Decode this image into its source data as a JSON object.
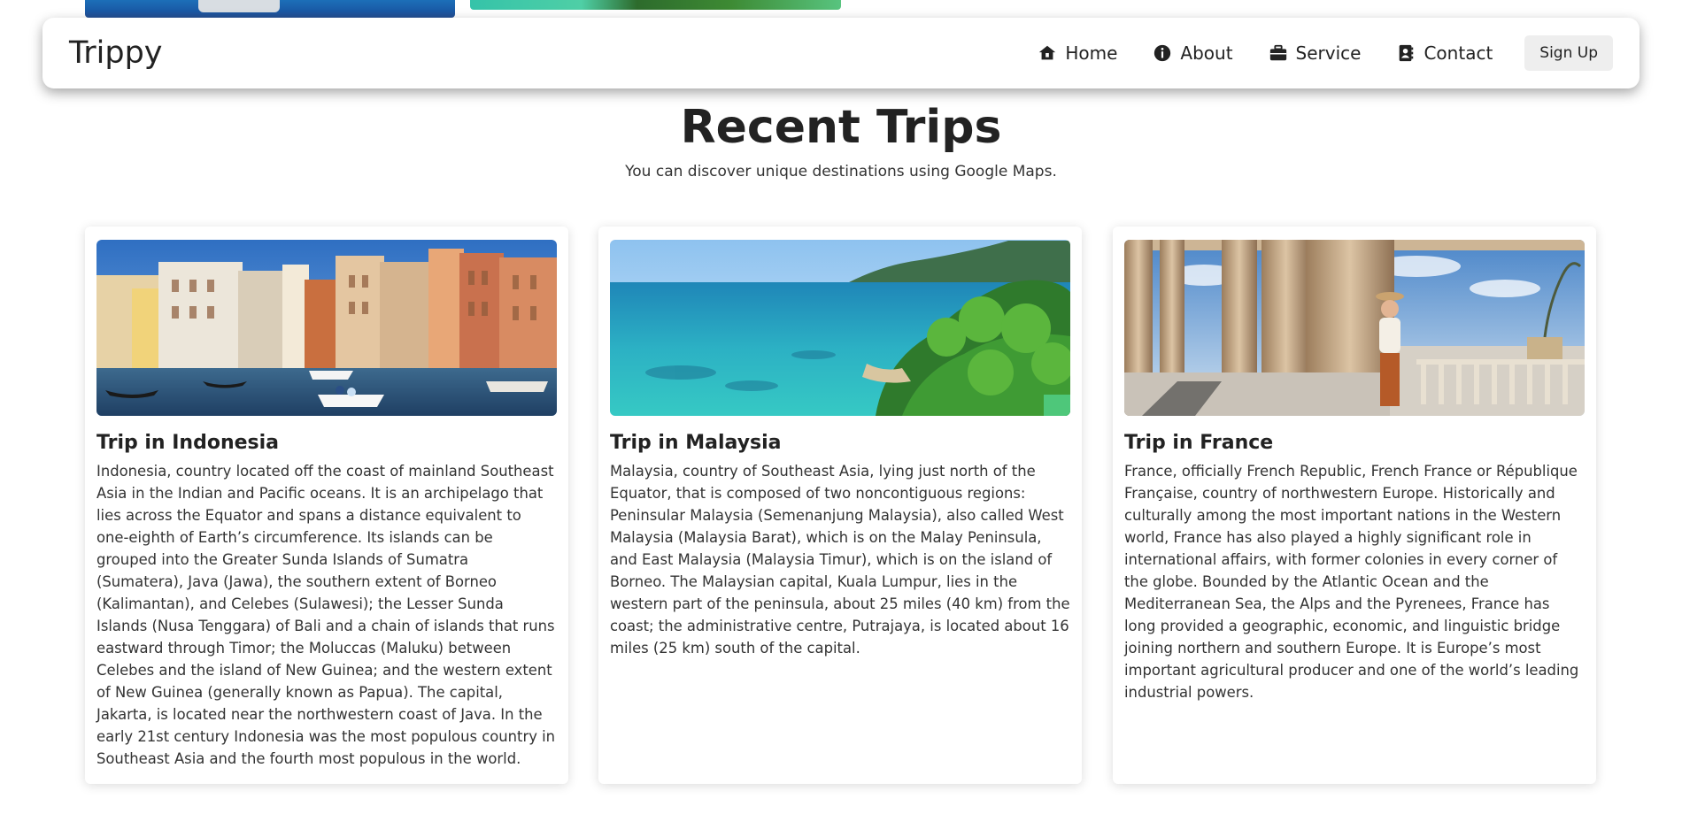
{
  "app": {
    "logo": "Trippy"
  },
  "nav": {
    "items": [
      {
        "label": "Home",
        "icon": "house-icon"
      },
      {
        "label": "About",
        "icon": "info-circle-icon"
      },
      {
        "label": "Service",
        "icon": "briefcase-icon"
      },
      {
        "label": "Contact",
        "icon": "address-book-icon"
      }
    ],
    "signup_label": "Sign Up"
  },
  "section": {
    "title": "Recent Trips",
    "subtitle": "You can discover unique destinations using Google Maps."
  },
  "trips": [
    {
      "title": "Trip in Indonesia",
      "image": "venice-canal-photo",
      "text": "Indonesia, country located off the coast of mainland Southeast Asia in the Indian and Pacific oceans. It is an archipelago that lies across the Equator and spans a distance equivalent to one-eighth of Earth’s circumference. Its islands can be grouped into the Greater Sunda Islands of Sumatra (Sumatera), Java (Jawa), the southern extent of Borneo (Kalimantan), and Celebes (Sulawesi); the Lesser Sunda Islands (Nusa Tenggara) of Bali and a chain of islands that runs eastward through Timor; the Moluccas (Maluku) between Celebes and the island of New Guinea; and the western extent of New Guinea (generally known as Papua). The capital, Jakarta, is located near the northwestern coast of Java. In the early 21st century Indonesia was the most populous country in Southeast Asia and the fourth most populous in the world."
    },
    {
      "title": "Trip in Malaysia",
      "image": "tropical-coast-photo",
      "text": "Malaysia, country of Southeast Asia, lying just north of the Equator, that is composed of two noncontiguous regions: Peninsular Malaysia (Semenanjung Malaysia), also called West Malaysia (Malaysia Barat), which is on the Malay Peninsula, and East Malaysia (Malaysia Timur), which is on the island of Borneo. The Malaysian capital, Kuala Lumpur, lies in the western part of the peninsula, about 25 miles (40 km) from the coast; the administrative centre, Putrajaya, is located about 16 miles (25 km) south of the capital."
    },
    {
      "title": "Trip in France",
      "image": "colonnade-terrace-photo",
      "text": "France, officially French Republic, French France or République Française, country of northwestern Europe. Historically and culturally among the most important nations in the Western world, France has also played a highly significant role in international affairs, with former colonies in every corner of the globe. Bounded by the Atlantic Ocean and the Mediterranean Sea, the Alps and the Pyrenees, France has long provided a geographic, economic, and linguistic bridge joining northern and southern Europe. It is Europe’s most important agricultural producer and one of the world’s leading industrial powers."
    }
  ]
}
